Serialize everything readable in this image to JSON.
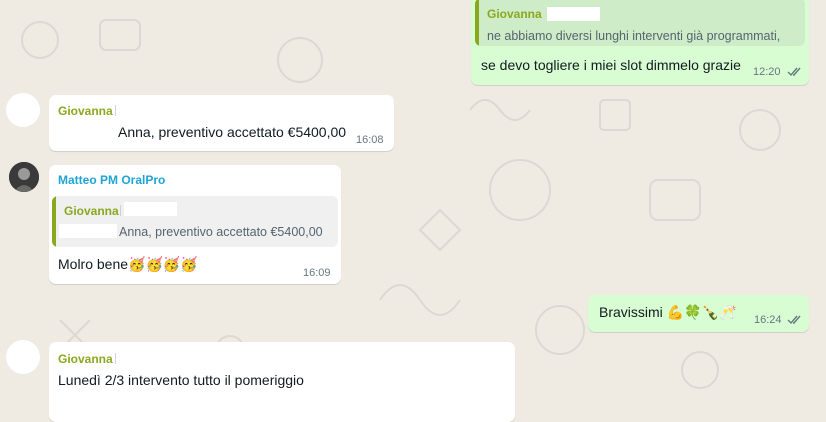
{
  "messages": {
    "top_out": {
      "quote_sender": "Giovanna",
      "quote_text": "ne abbiamo diversi lunghi  interventi già programmati,",
      "text": "se devo togliere i miei slot dimmelo grazie",
      "time": "12:20"
    },
    "giovanna_1": {
      "sender": "Giovanna",
      "text": "Anna, preventivo accettato €5400,00",
      "time": "16:08"
    },
    "matteo": {
      "sender": "Matteo PM OralPro",
      "quote_sender": "Giovanna",
      "quote_text": "Anna, preventivo accettato €5400,00",
      "text": "Molro bene",
      "emojis": "🥳🥳🥳🥳",
      "time": "16:09"
    },
    "out_bravissimi": {
      "text": "Bravissimi",
      "emojis": "💪🍀🍾🥂",
      "time": "16:24"
    },
    "giovanna_2": {
      "sender": "Giovanna",
      "text": "Lunedì 2/3 intervento tutto il pomeriggio"
    }
  },
  "colors": {
    "background": "#efeae2",
    "incoming": "#ffffff",
    "outgoing": "#d9fdd3",
    "sender_green": "#8aa81d",
    "sender_blue": "#20a4d6",
    "read_ticks": "#53bdeb"
  }
}
